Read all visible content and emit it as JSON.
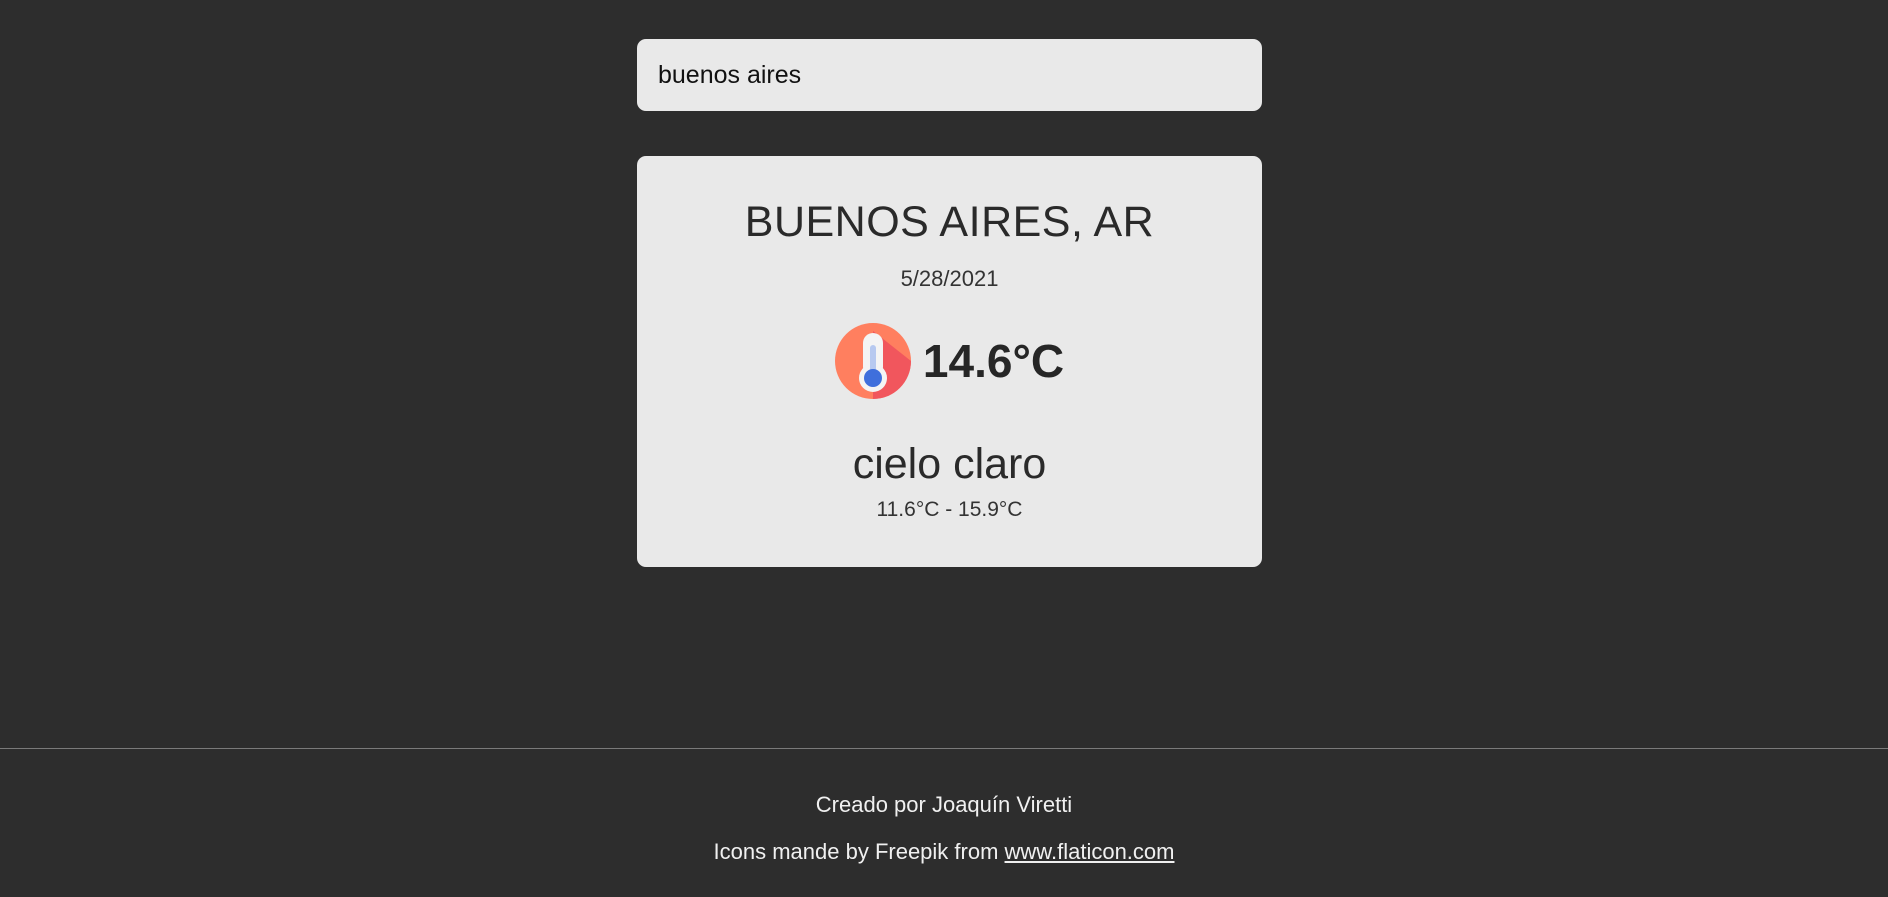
{
  "search": {
    "value": "buenos aires"
  },
  "weather": {
    "city": "BUENOS AIRES, AR",
    "date": "5/28/2021",
    "temperature": "14.6°C",
    "icon": "thermometer-icon",
    "description": "cielo claro",
    "range": "11.6°C - 15.9°C"
  },
  "footer": {
    "credit": "Creado por Joaquín Viretti",
    "icons_prefix": "Icons mande by Freepik from ",
    "icons_link": "www.flaticon.com"
  },
  "colors": {
    "background": "#2d2d2d",
    "card": "#e9e9e9",
    "icon_circle": "#ff7f5f",
    "icon_shadow": "#ee4f5d",
    "icon_mercury": "#3f6fdc"
  }
}
